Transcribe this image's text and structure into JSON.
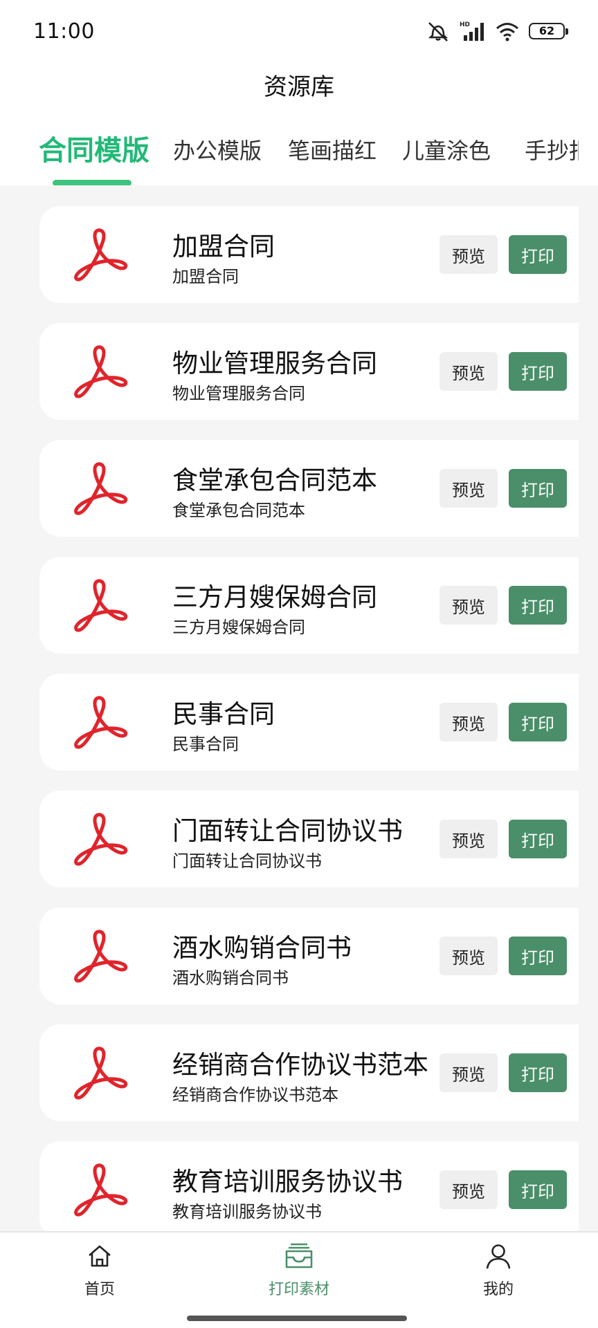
{
  "status_bar": {
    "time": "11:00",
    "network_label": "HD",
    "battery_level": "62"
  },
  "header": {
    "title": "资源库"
  },
  "tabs": [
    {
      "label": "合同模版",
      "active": true
    },
    {
      "label": "办公模版",
      "active": false
    },
    {
      "label": "笔画描红",
      "active": false
    },
    {
      "label": "儿童涂色",
      "active": false
    },
    {
      "label": "手抄报",
      "active": false
    }
  ],
  "items": [
    {
      "title": "加盟合同",
      "subtitle": "加盟合同"
    },
    {
      "title": "物业管理服务合同",
      "subtitle": "物业管理服务合同"
    },
    {
      "title": "食堂承包合同范本",
      "subtitle": "食堂承包合同范本"
    },
    {
      "title": "三方月嫂保姆合同",
      "subtitle": "三方月嫂保姆合同"
    },
    {
      "title": "民事合同",
      "subtitle": "民事合同"
    },
    {
      "title": "门面转让合同协议书",
      "subtitle": "门面转让合同协议书"
    },
    {
      "title": "酒水购销合同书",
      "subtitle": "酒水购销合同书"
    },
    {
      "title": "经销商合作协议书范本",
      "subtitle": "经销商合作协议书范本"
    },
    {
      "title": "教育培训服务协议书",
      "subtitle": "教育培训服务协议书"
    }
  ],
  "buttons": {
    "preview_label": "预览",
    "print_label": "打印"
  },
  "bottom_nav": [
    {
      "label": "首页",
      "icon": "home-icon",
      "active": false
    },
    {
      "label": "打印素材",
      "icon": "tray-icon",
      "active": true
    },
    {
      "label": "我的",
      "icon": "user-icon",
      "active": false
    }
  ],
  "colors": {
    "accent_green": "#22b978",
    "print_button": "#4a8f69",
    "pdf_red": "#e0242b"
  }
}
